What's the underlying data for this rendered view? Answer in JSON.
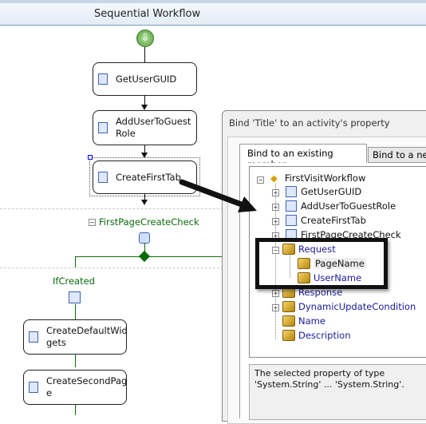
{
  "designer": {
    "title": "Sequential Workflow",
    "activities": [
      "GetUserGUID",
      "AddUserToGuest Role",
      "CreateFirstTab"
    ],
    "ifelse": {
      "label": "FirstPageCreateCheck",
      "branch": "IfCreated",
      "branch_activities": [
        "CreateDefaultWid gets",
        "CreateSecondPag e"
      ]
    }
  },
  "dialog": {
    "title": "Bind 'Title' to an activity's property",
    "tabs": [
      {
        "label": "Bind to an existing member",
        "active": true
      },
      {
        "label": "Bind to a new member",
        "active": false
      }
    ],
    "tree": {
      "root": "FirstVisitWorkflow",
      "items": [
        "GetUserGUID",
        "AddUserToGuestRole",
        "CreateFirstTab",
        "FirstPageCreateCheck"
      ],
      "request": "Request",
      "request_children": [
        "PageName",
        "UserName"
      ],
      "props": [
        "Response",
        "DynamicUpdateCondition",
        "Name",
        "Description"
      ]
    },
    "description": "The selected property of type 'System.String' ... 'System.String'."
  },
  "colors": {
    "accent_green": "#0b6b0b",
    "link_blue": "#1a1a9a"
  }
}
